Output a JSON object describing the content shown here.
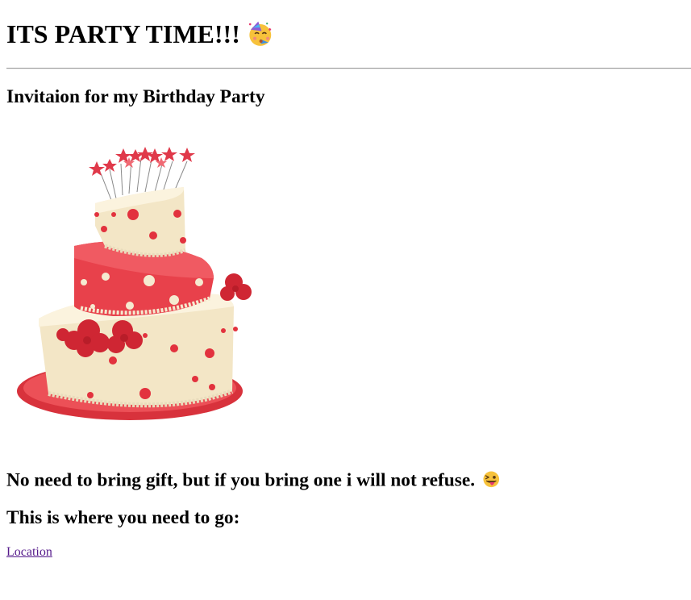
{
  "header": {
    "title": "ITS PARTY TIME!!!",
    "title_emoji": "partying-face-emoji"
  },
  "invitation": {
    "heading": "Invitaion for my Birthday Party"
  },
  "image": {
    "subject": "cake-image"
  },
  "gift_note": {
    "text": "No need to bring gift, but if you bring one i will not refuse.",
    "emoji": "winking-tongue-face-emoji"
  },
  "directions": {
    "heading": "This is where you need to go:",
    "link_label": "Location"
  },
  "colors": {
    "link": "#551a8b",
    "cake_red": "#e23c44",
    "cake_cream": "#f5ead0"
  }
}
